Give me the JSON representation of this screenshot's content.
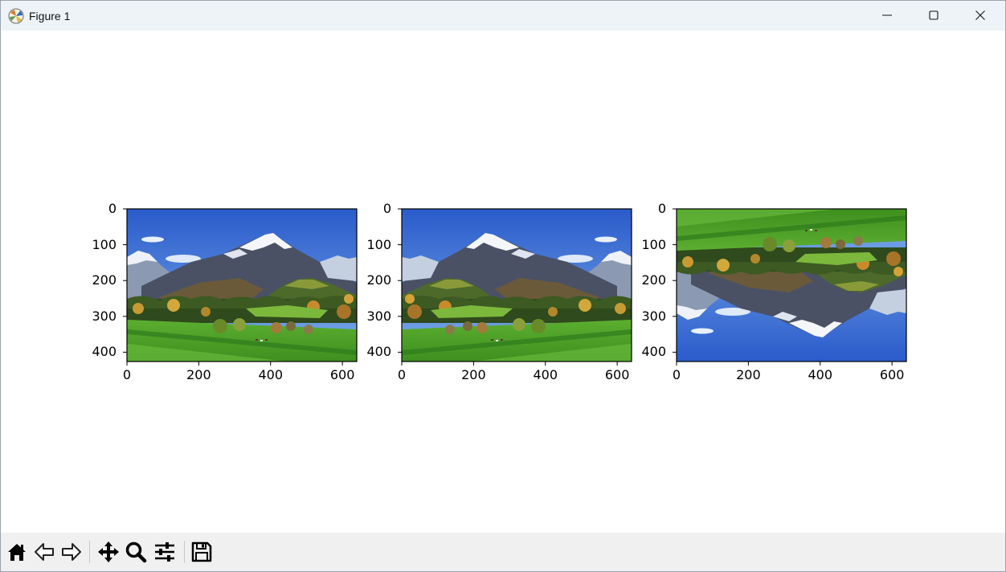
{
  "window": {
    "title": "Figure 1",
    "icons": {
      "app": "matplotlib-logo-icon",
      "minimize": "minimize-icon",
      "maximize": "maximize-icon",
      "close": "close-icon"
    }
  },
  "figure": {
    "subplots": [
      {
        "name": "original",
        "y_ticks": [
          "0",
          "100",
          "200",
          "300",
          "400"
        ],
        "x_ticks": [
          "0",
          "200",
          "400",
          "600"
        ],
        "flip": "none"
      },
      {
        "name": "flipped-horizontal",
        "y_ticks": [
          "0",
          "100",
          "200",
          "300",
          "400"
        ],
        "x_ticks": [
          "0",
          "200",
          "400",
          "600"
        ],
        "flip": "horizontal"
      },
      {
        "name": "flipped-vertical",
        "y_ticks": [
          "0",
          "100",
          "200",
          "300",
          "400"
        ],
        "x_ticks": [
          "0",
          "200",
          "400",
          "600"
        ],
        "flip": "vertical"
      }
    ],
    "image_extent": {
      "x": [
        0,
        640
      ],
      "y": [
        0,
        426
      ]
    }
  },
  "toolbar": {
    "buttons": [
      {
        "name": "home-button",
        "icon": "home-icon"
      },
      {
        "name": "back-button",
        "icon": "back-arrow-icon"
      },
      {
        "name": "forward-button",
        "icon": "forward-arrow-icon"
      },
      {
        "name": "pan-button",
        "icon": "move-icon"
      },
      {
        "name": "zoom-button",
        "icon": "magnifier-icon"
      },
      {
        "name": "configure-subplots-button",
        "icon": "sliders-icon"
      },
      {
        "name": "save-button",
        "icon": "floppy-disk-icon"
      }
    ]
  },
  "colors": {
    "titlebar": "#eef3f7",
    "toolbar": "#f0f0f0",
    "sky_top": "#2d5fd0",
    "sky_bottom": "#9ec3f0",
    "mountain": "#3c4a5e",
    "snow": "#f2f4f8",
    "forest": "#2f4a1c",
    "meadow": "#56a82c",
    "autumn": "#c9a23a"
  }
}
